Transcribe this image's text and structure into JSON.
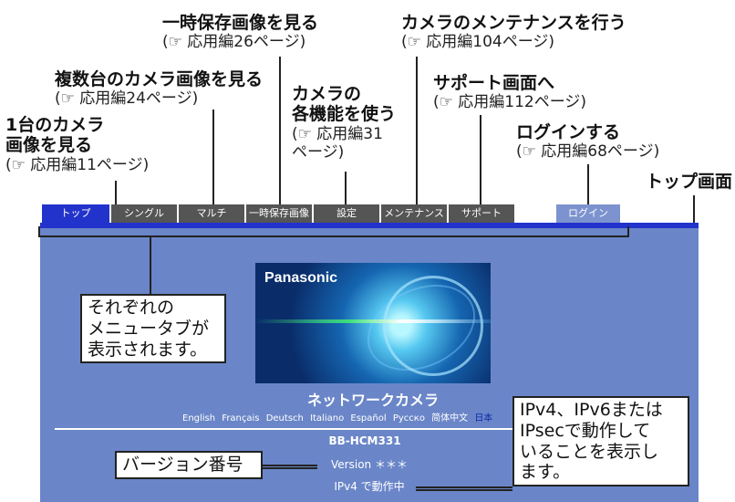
{
  "annotations": {
    "single_camera": {
      "heading_line1": "1台のカメラ",
      "heading_line2": "画像を見る",
      "ref": "(☞ 応用編11ページ)"
    },
    "multi_camera": {
      "heading": "複数台のカメラ画像を見る",
      "ref": "(☞ 応用編24ページ)"
    },
    "buffered_image": {
      "heading": "一時保存画像を見る",
      "ref": "(☞ 応用編26ページ)"
    },
    "functions": {
      "heading_line1": "カメラの",
      "heading_line2": "各機能を使う",
      "ref_line1": "(☞ 応用編31",
      "ref_line2": "ページ)"
    },
    "maintenance": {
      "heading": "カメラのメンテナンスを行う",
      "ref": "(☞ 応用編104ページ)"
    },
    "support": {
      "heading": "サポート画面へ",
      "ref": "(☞ 応用編112ページ)"
    },
    "login": {
      "heading": "ログインする",
      "ref": "(☞ 応用編68ページ)"
    },
    "top_screen": "トップ画面"
  },
  "tabs": [
    {
      "label": "トップ",
      "style": "active"
    },
    {
      "label": "シングル",
      "style": "gray"
    },
    {
      "label": "マルチ",
      "style": "gray"
    },
    {
      "label": "一時保存画像",
      "style": "gray"
    },
    {
      "label": "設定",
      "style": "gray"
    },
    {
      "label": "メンテナンス",
      "style": "gray"
    },
    {
      "label": "サポート",
      "style": "gray"
    },
    {
      "label": "ログイン",
      "style": "login"
    }
  ],
  "screen": {
    "brand": "Panasonic",
    "title": "ネットワークカメラ",
    "languages": [
      "English",
      "Français",
      "Deutsch",
      "Italiano",
      "Español",
      "Русско",
      "简体中文",
      "日本"
    ],
    "model": "BB-HCM331",
    "version": "Version ＊＊＊",
    "ip_mode": "IPv4 で動作中"
  },
  "callouts": {
    "menu_tabs": [
      "それぞれの",
      "メニュータブが",
      "表示されます。"
    ],
    "version_no": "バージョン番号",
    "ip_note": [
      "IPv4、IPv6または",
      "IPsecで動作して",
      "いることを表示し",
      "ます。"
    ]
  },
  "colors": {
    "screen_bg": "#6a86c8",
    "active_tab": "#2233cc",
    "gray_tab": "#555555",
    "login_tab": "#7d93cf"
  }
}
